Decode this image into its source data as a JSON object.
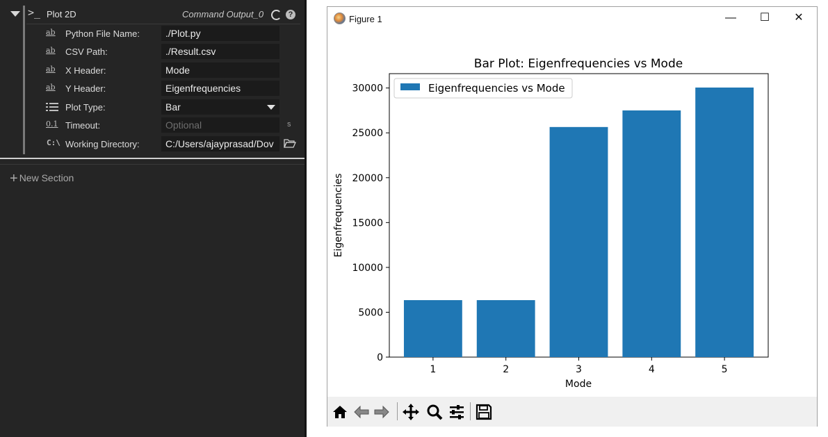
{
  "left_panel": {
    "node": {
      "title": "Plot 2D",
      "output": "Command Output_0",
      "cmd_icon": "terminal-icon"
    },
    "properties": [
      {
        "icon": "ab",
        "label": "Python File Name:",
        "value": "./Plot.py",
        "placeholder": false
      },
      {
        "icon": "ab",
        "label": "CSV Path:",
        "value": "./Result.csv",
        "placeholder": false
      },
      {
        "icon": "ab",
        "label": "X Header:",
        "value": "Mode",
        "placeholder": false
      },
      {
        "icon": "ab",
        "label": "Y Header:",
        "value": "Eigenfrequencies",
        "placeholder": false
      },
      {
        "icon": "list",
        "label": "Plot Type:",
        "value": "Bar",
        "placeholder": false
      },
      {
        "icon": "0.1",
        "label": "Timeout:",
        "value": "Optional",
        "placeholder": true,
        "unit": "s"
      },
      {
        "icon": "C:\\",
        "label": "Working Directory:",
        "value": "C:/Users/ajayprasad/Dov",
        "placeholder": false
      }
    ],
    "new_section_label": "New Section"
  },
  "figure_window": {
    "title": "Figure 1",
    "controls": {
      "minimize": "—",
      "maximize": "☐",
      "close": "✕"
    },
    "toolbar": [
      "home-icon",
      "back-icon",
      "forward-icon",
      "pan-icon",
      "zoom-icon",
      "configure-subplots-icon",
      "save-icon"
    ]
  },
  "chart_data": {
    "type": "bar",
    "title": "Bar Plot: Eigenfrequencies vs Mode",
    "xlabel": "Mode",
    "ylabel": "Eigenfrequencies",
    "categories": [
      "1",
      "2",
      "3",
      "4",
      "5"
    ],
    "series": [
      {
        "name": "Eigenfrequencies vs Mode",
        "values": [
          6350,
          6350,
          25650,
          27500,
          30050
        ],
        "color": "#1f77b4"
      }
    ],
    "ylim": [
      0,
      31600
    ],
    "yticks": [
      0,
      5000,
      10000,
      15000,
      20000,
      25000,
      30000
    ],
    "legend": "top-left",
    "grid": false
  }
}
